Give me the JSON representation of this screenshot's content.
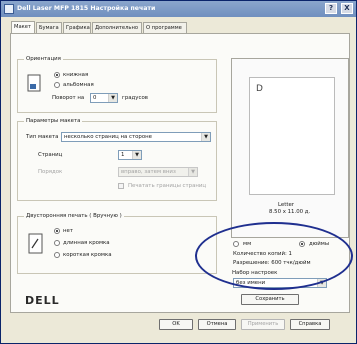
{
  "window": {
    "title": "Dell Laser MFP 1815 Настройка печати",
    "help": "?",
    "close": "X"
  },
  "tabs": [
    "Макет",
    "Бумага",
    "Графика",
    "Дополнительно",
    "О программе"
  ],
  "orientation": {
    "label": "Ориентация",
    "portrait": "книжная",
    "landscape": "альбомная",
    "rotate_label": "Поворот на",
    "rotate_value": "0",
    "rotate_unit": "градусов"
  },
  "layout": {
    "label": "Параметры макета",
    "type_label": "Тип макета",
    "type_value": "несколько страниц на стороне",
    "pages_label": "Страниц",
    "pages_value": "1",
    "order_label": "Порядок",
    "order_value": "вправо, затем вниз",
    "border_label": "Печатать границы страниц"
  },
  "duplex": {
    "label": "Двусторонняя печать ( Вручную )",
    "none": "нет",
    "long": "длинная кромка",
    "short": "короткая кромка"
  },
  "preview": {
    "paper": "Letter",
    "size": "8.50 x 11.00 д."
  },
  "units": {
    "mm": "мм",
    "inch": "дюймы"
  },
  "info": {
    "copies": "Количество копий: 1",
    "resolution": "Разрешение: 600 тчк/дюйм"
  },
  "presets": {
    "label": "Набор настроек",
    "value": "без имени",
    "save": "Сохранить"
  },
  "brand": "DELL",
  "buttons": {
    "ok": "OK",
    "cancel": "Отмена",
    "apply": "Применить",
    "help": "Справка"
  }
}
